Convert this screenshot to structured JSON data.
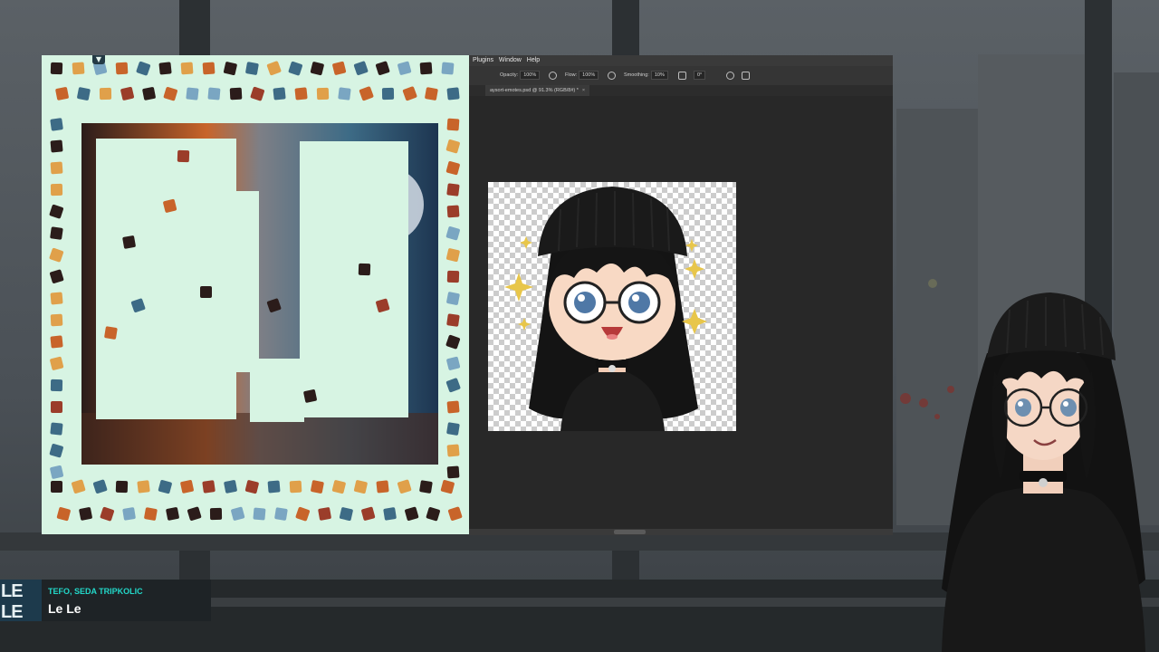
{
  "puzzle": {
    "collapse_icon": "chevron-double-down-icon",
    "colors": {
      "background": "#d7f4e3",
      "fire": "#c8642a",
      "ocean": "#3d6b86",
      "dark": "#2b1c1a"
    }
  },
  "photoshop": {
    "menu": [
      "Plugins",
      "Window",
      "Help"
    ],
    "options": {
      "opacity_label": "Opacity:",
      "opacity_value": "100%",
      "flow_label": "Flow:",
      "flow_value": "100%",
      "smoothing_label": "Smoothing:",
      "smoothing_value": "10%",
      "angle_value": "0°"
    },
    "tab_title": "aysort-emotes.psd @ 91.3% (RGB/8#) *",
    "tab_close": "×"
  },
  "now_playing": {
    "artist": "TEFO, SEDA TRIPKOLIC",
    "title": "Le Le",
    "art_text": "LE LE"
  },
  "icons": [
    "chevron-double-down-icon",
    "brush-pressure-icon",
    "airbrush-icon",
    "gear-icon",
    "symmetry-icon",
    "close-icon"
  ]
}
